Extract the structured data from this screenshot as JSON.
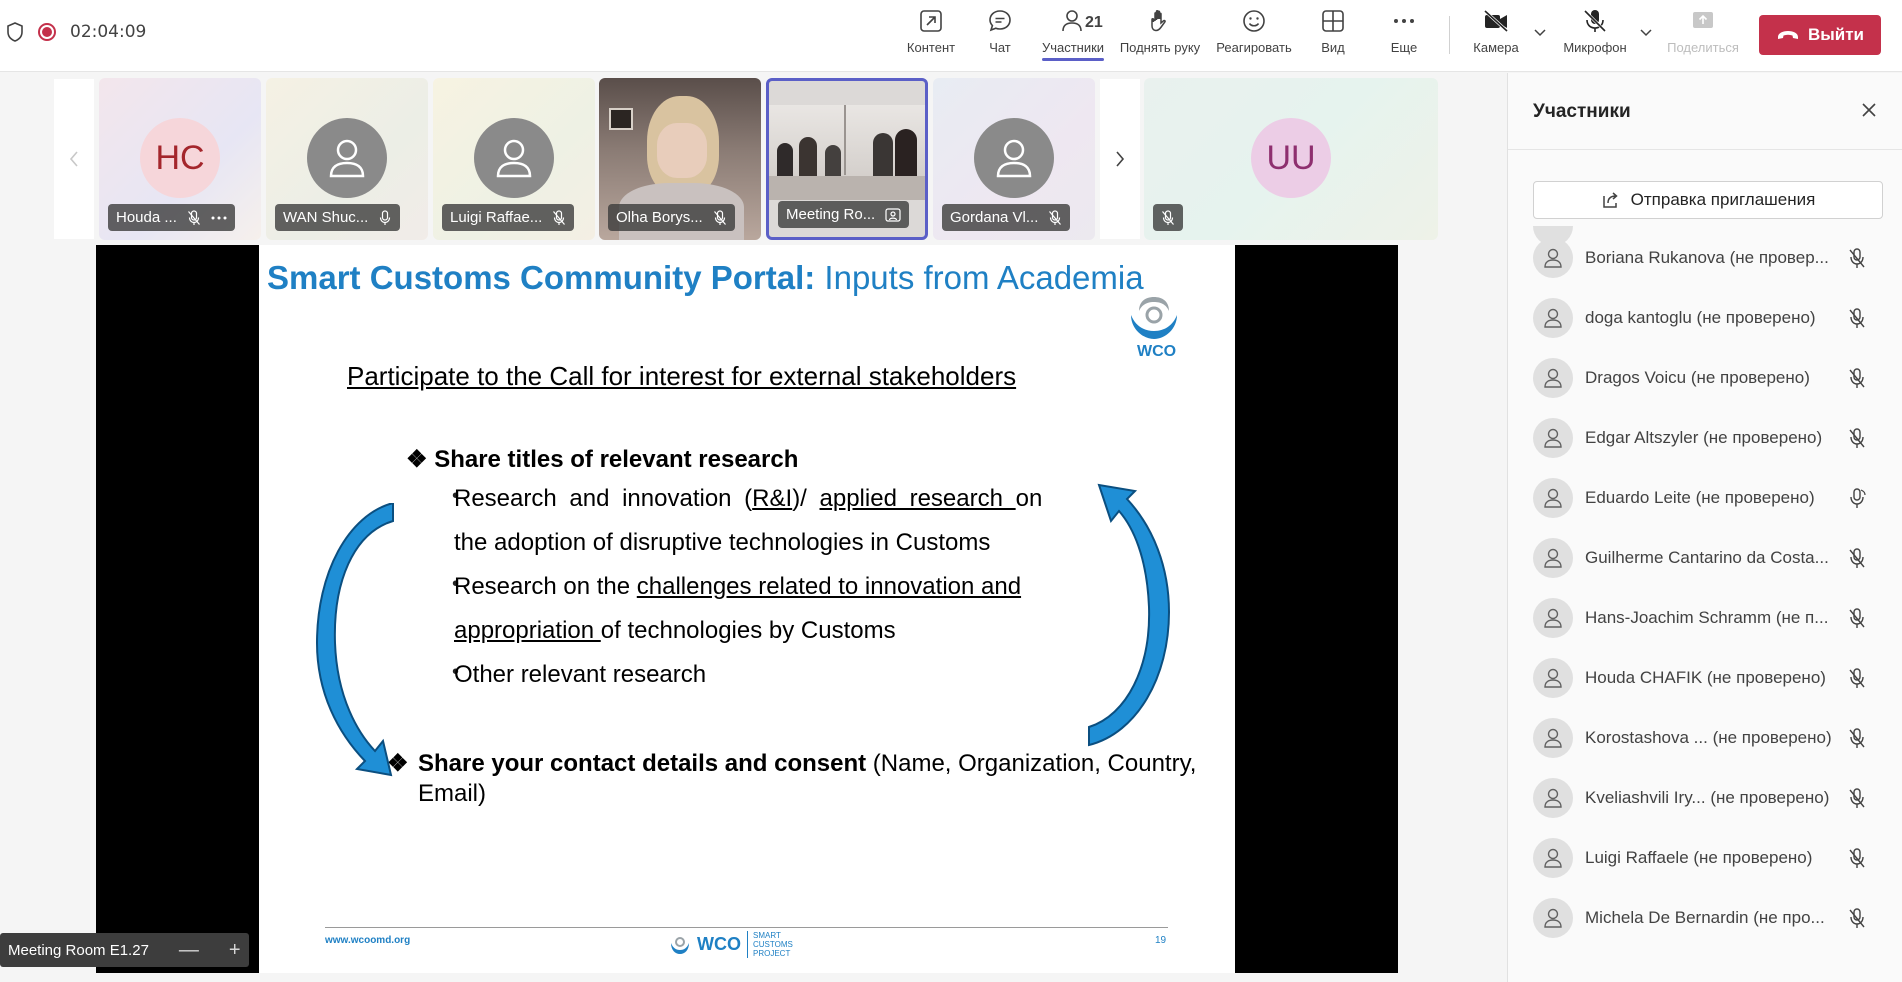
{
  "topbar": {
    "timer": "02:04:09",
    "buttons": {
      "content": "Контент",
      "chat": "Чат",
      "participants": "Участники",
      "participants_count": "21",
      "raise_hand": "Поднять руку",
      "react": "Реагировать",
      "view": "Вид",
      "more": "Еще",
      "camera": "Камера",
      "mic": "Микрофон",
      "share": "Поделиться"
    },
    "leave_label": "Выйти"
  },
  "strip": {
    "tiles": [
      {
        "initials": "HC",
        "name": "Houda ...",
        "avatar_color": "#f6d6da",
        "initials_color": "#a4262c"
      },
      {
        "name": "WAN Shuc..."
      },
      {
        "name": "Luigi Raffae..."
      },
      {
        "name": "Olha Borys..."
      },
      {
        "name": "Meeting Ro..."
      },
      {
        "name": "Gordana Vl..."
      },
      {
        "initials": "UU",
        "avatar_color": "#eccde6",
        "initials_color": "#8e2f6f"
      }
    ]
  },
  "slide": {
    "title_bold": "Smart Customs Community Portal:",
    "title_rest": " Inputs from Academia",
    "logo_text": "WCO",
    "subtitle": "Participate to the Call for interest for external stakeholders",
    "bullet1": "Share titles of relevant research",
    "sub_bullets": [
      {
        "pre": "Research and innovation (",
        "u1": "R&I",
        "mid": ")/ ",
        "u2": "applied research ",
        "post": "on"
      },
      {
        "text": "the adoption of disruptive technologies in Customs"
      },
      {
        "pre": "Research on the ",
        "u1": "challenges related to innovation and"
      },
      {
        "u1": "appropriation ",
        "post": "of technologies by Customs"
      },
      {
        "text": "Other relevant research"
      }
    ],
    "bullet2_bold": "Share your contact details and consent",
    "bullet2_rest": "  (Name, Organization, Country, Email)",
    "footer_url": "www.wcoomd.org",
    "footer_logo": "WCO",
    "footer_project": "SMART CUSTOMS PROJECT",
    "page": "19"
  },
  "room_tag": {
    "name": "Meeting Room E1.27",
    "minus": "—",
    "plus": "+"
  },
  "panel": {
    "title": "Участники",
    "invite_label": "Отправка приглашения",
    "participants": [
      {
        "name": "Boriana Rukanova (не провер...",
        "mic": "muted"
      },
      {
        "name": "doga kantoglu (не проверено)",
        "mic": "muted"
      },
      {
        "name": "Dragos Voicu (не проверено)",
        "mic": "muted"
      },
      {
        "name": "Edgar Altszyler (не проверено)",
        "mic": "muted"
      },
      {
        "name": "Eduardo Leite (не проверено)",
        "mic": "on"
      },
      {
        "name": "Guilherme Cantarino da Costa...",
        "mic": "muted"
      },
      {
        "name": "Hans-Joachim Schramm (не п...",
        "mic": "muted"
      },
      {
        "name": "Houda CHAFIK (не проверено)",
        "mic": "muted"
      },
      {
        "name": "Korostashova ... (не проверено)",
        "mic": "muted"
      },
      {
        "name": "Kveliashvili Iry... (не проверено)",
        "mic": "muted"
      },
      {
        "name": "Luigi Raffaele (не проверено)",
        "mic": "muted"
      },
      {
        "name": "Michela De Bernardin (не про...",
        "mic": "muted"
      }
    ]
  },
  "colors": {
    "accent": "#5b5fc7",
    "leave": "#c4314b",
    "slide_blue": "#1f80c4"
  }
}
